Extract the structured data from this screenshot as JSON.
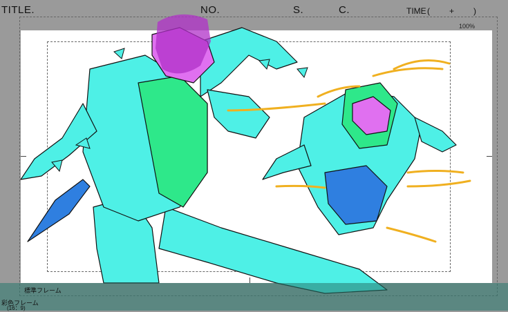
{
  "header": {
    "title_label": "TITLE.",
    "no_label": "NO.",
    "s_label": "S.",
    "c_label": "C.",
    "time_label": "TIME",
    "time_open": "(",
    "time_plus": "+",
    "time_close": ")"
  },
  "zoom": "100%",
  "frames": {
    "standard_frame_label": "標準フレーム",
    "color_frame_label": "彩色フレーム",
    "aspect_ratio": "(16：9)"
  },
  "colors": {
    "cyan": "#4ef0e6",
    "green": "#2ee88a",
    "magenta": "#b030c8",
    "blue": "#2f7fe0",
    "gold": "#f0b020"
  }
}
